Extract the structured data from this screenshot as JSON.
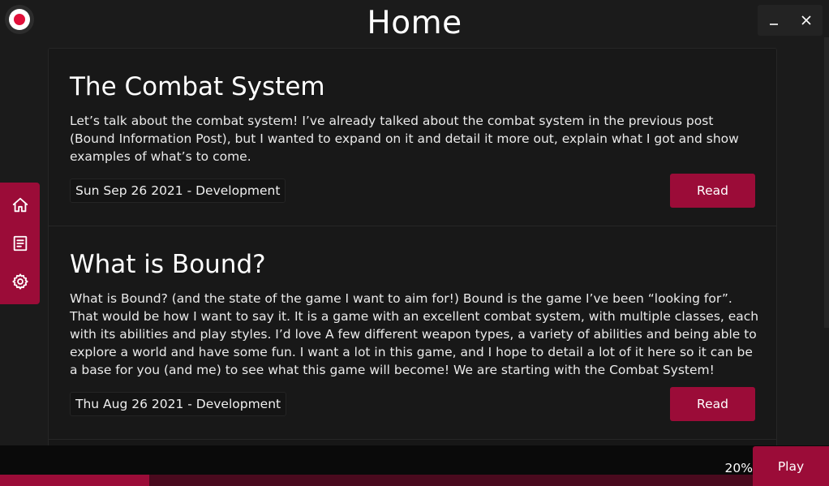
{
  "window": {
    "title": "Home",
    "minimize_icon": "minimize-icon",
    "close_icon": "close-icon"
  },
  "logo": {
    "icon": "record-logo-icon",
    "accent": "#e0103a"
  },
  "sidebar": {
    "items": [
      {
        "icon": "home-icon"
      },
      {
        "icon": "document-icon"
      },
      {
        "icon": "gear-icon"
      }
    ],
    "color": "#9b0c38"
  },
  "posts": [
    {
      "title": "The Combat System",
      "body": "Let’s talk about the combat system! I’ve already talked about the combat system in the previous post (Bound Information Post), but I wanted to expand on it and detail it more out, explain what I got and show examples of what’s to come.",
      "meta": "Sun Sep 26 2021 - Development",
      "button": "Read"
    },
    {
      "title": "What is Bound?",
      "body": "What is Bound? (and the state of the game I want to aim for!) Bound is the game I’ve been “looking for”. That would be how I want to say it. It is a game with an excellent combat system, with multiple classes, each with its abilities and play styles. I’d love A few different weapon types, a variety of abilities and being able to explore a world and have some fun. I want a lot in this game, and I hope to detail a lot of it here so it can be a base for you (and me) to see what this game will become! We are starting with the Combat System!",
      "meta": "Thu Aug 26 2021 - Development",
      "button": "Read"
    }
  ],
  "footer": {
    "progress_text": "20%",
    "progress_value": 0.18,
    "play_label": "Play"
  },
  "colors": {
    "accent": "#9b0c38",
    "background": "#1b1b1b"
  }
}
